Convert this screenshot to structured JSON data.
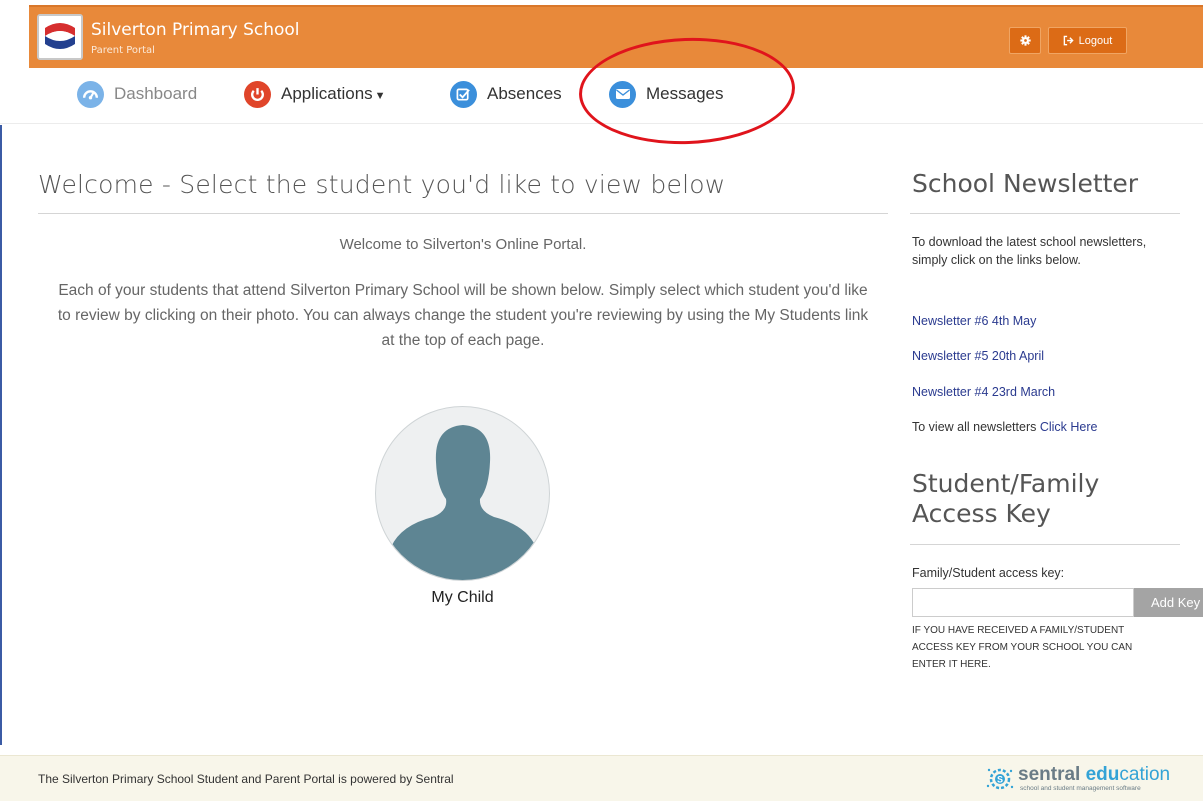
{
  "header": {
    "school_name": "Silverton Primary School",
    "subtitle": "Parent Portal",
    "settings_icon": "gear-icon",
    "logout_label": "Logout",
    "accent_color": "#e8893a"
  },
  "nav": {
    "items": [
      {
        "label": "Dashboard",
        "icon": "dashboard-icon"
      },
      {
        "label": "Applications",
        "icon": "power-icon",
        "has_dropdown": true
      },
      {
        "label": "Absences",
        "icon": "check-icon"
      },
      {
        "label": "Messages",
        "icon": "envelope-icon"
      }
    ]
  },
  "main": {
    "title": "Welcome - Select the student you'd like to view below",
    "welcome": "Welcome to Silverton's Online Portal.",
    "intro": "Each of your students that attend Silverton Primary School will be shown below. Simply select which student you'd like to review by clicking on their photo. You can always change the student you're reviewing by using the My Students link at the top of each page.",
    "students": [
      {
        "name": "My Child"
      }
    ]
  },
  "sidebar": {
    "newsletter_title": "School Newsletter",
    "newsletter_text": "To download the latest school newsletters, simply click on the links below.",
    "newsletters": [
      "Newsletter #6 4th May",
      "Newsletter #5 20th April",
      "Newsletter #4 23rd March"
    ],
    "view_all_prefix": "To view all newsletters",
    "view_all_link": "Click Here",
    "key_title": "Student/Family Access Key",
    "key_label": "Family/Student access key:",
    "key_input_value": "",
    "key_button": "Add Key",
    "key_help": "If you have received a family/student access key from your school you can enter it here."
  },
  "footer": {
    "text": "The Silverton Primary School Student and Parent Portal is powered by Sentral",
    "brand_bold": "sentral",
    "brand_edu": "edu",
    "brand_light": "cation",
    "brand_tagline": "school and student management software"
  }
}
